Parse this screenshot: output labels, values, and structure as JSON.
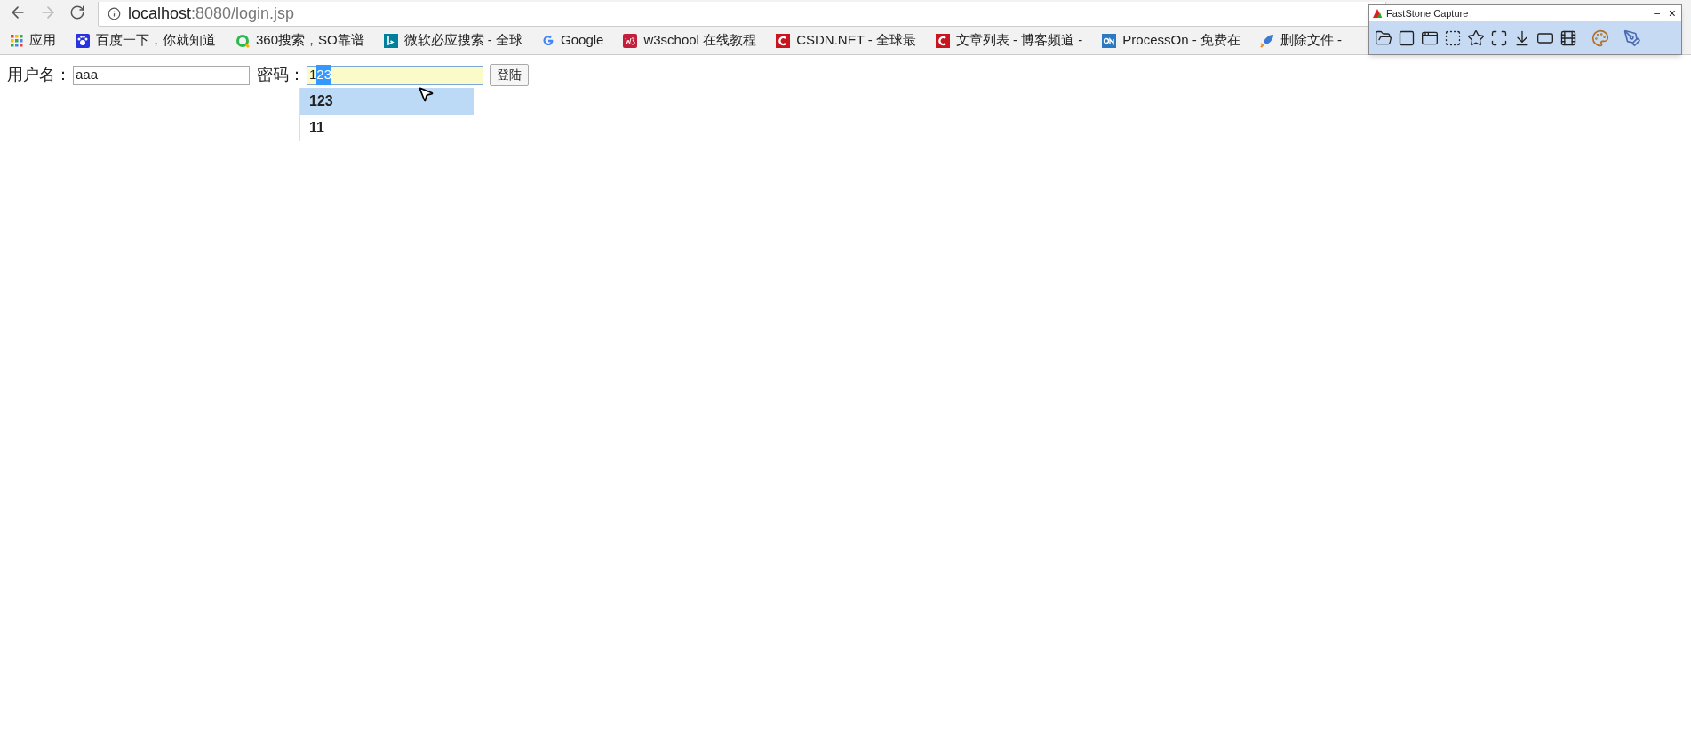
{
  "browser": {
    "address": {
      "host": "localhost",
      "rest": ":8080/login.jsp"
    },
    "bookmarks": [
      {
        "kind": "apps",
        "label": "应用"
      },
      {
        "kind": "paw",
        "label": "百度一下，你就知道"
      },
      {
        "kind": "ring",
        "label": "360搜索，SO靠谱"
      },
      {
        "kind": "bing",
        "label": "微软必应搜索 - 全球"
      },
      {
        "kind": "google",
        "label": "Google"
      },
      {
        "kind": "w3",
        "label": "w3school 在线教程"
      },
      {
        "kind": "csdn",
        "label": "CSDN.NET - 全球最"
      },
      {
        "kind": "csdn",
        "label": "文章列表 - 博客频道 -"
      },
      {
        "kind": "on",
        "label": "ProcessOn - 免费在"
      },
      {
        "kind": "rocket",
        "label": "删除文件 -"
      }
    ]
  },
  "form": {
    "username_label": "用户名：",
    "username_value": "aaa",
    "password_label": "密码：",
    "password_typed": "1",
    "password_selected": "23",
    "submit": "登陆"
  },
  "autocomplete": [
    {
      "label": "123",
      "selected": true
    },
    {
      "label": "11",
      "selected": false
    }
  ],
  "capture_tool": {
    "title": "FastStone Capture",
    "minimize": "–",
    "close": "×"
  }
}
